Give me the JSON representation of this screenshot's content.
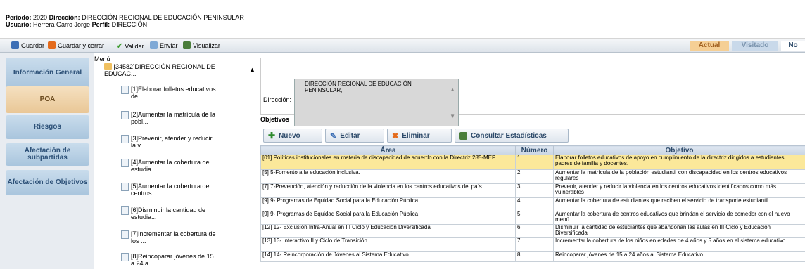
{
  "header": {
    "periodo_label": "Periodo:",
    "periodo_value": "2020",
    "direccion_label": "Dirección:",
    "direccion_value": "DIRECCIÓN REGIONAL DE EDUCACIÓN PENINSULAR",
    "usuario_label": "Usuario:",
    "usuario_value": "Herrera Garro Jorge",
    "perfil_label": "Perfil:",
    "perfil_value": "DIRECCIÓN"
  },
  "toolbar": {
    "guardar": "Guardar",
    "guardar_cerrar": "Guardar y cerrar",
    "validar": "Validar",
    "enviar": "Enviar",
    "visualizar": "Visualizar",
    "tab_actual": "Actual",
    "tab_visitado": "Visitado",
    "tab_no": "No"
  },
  "sidebar": {
    "items": [
      {
        "label": "Información General"
      },
      {
        "label": "POA"
      },
      {
        "label": "Riesgos"
      },
      {
        "label": "Afectación de subpartidas"
      },
      {
        "label": "Afectación de Objetivos"
      }
    ]
  },
  "menu": {
    "title": "Menú",
    "root": "[34582]DIRECCIÓN REGIONAL DE EDUCAC...",
    "items": [
      "[1]Elaborar folletos educativos de ...",
      "[2]Aumentar la matrícula de la pobl...",
      "[3]Prevenir, atender y reducir la v...",
      "[4]Aumentar la cobertura de estudia...",
      "[5]Aumentar la cobertura de centros...",
      "[6]Disminuir la cantidad de estudia...",
      "[7]Incrementar la cobertura de los ...",
      "[8]Reincoparar jóvenes de 15 a 24 a..."
    ]
  },
  "direccion": {
    "label": "Dirección:",
    "value": "DIRECCIÓN REGIONAL DE EDUCACIÓN PENINSULAR,"
  },
  "objetivos": {
    "title": "Objetivos",
    "nuevo": "Nuevo",
    "editar": "Editar",
    "eliminar": "Eliminar",
    "consultar": "Consultar Estadísticas",
    "columns": [
      "Área",
      "Número",
      "Objetivo"
    ],
    "rows": [
      {
        "area": "[01] Políticas institucionales en materia de discapacidad de acuerdo con la Directriz 285-MEP",
        "numero": "1",
        "objetivo": "Elaborar folletos educativos de apoyo en cumplimiento de la directriz dirigidos a estudiantes, padres de familia y docentes."
      },
      {
        "area": "[5] 5-Fomento a la educación inclusiva.",
        "numero": "2",
        "objetivo": "Aumentar la matrícula de la población estudiantil con discapacidad en los centros educativos regulares"
      },
      {
        "area": "[7] 7-Prevención, atención y reducción de la violencia en los centros educativos del país.",
        "numero": "3",
        "objetivo": "Prevenir, atender y reducir la violencia en los centros educativos identificados como más vulnerables"
      },
      {
        "area": "[9] 9- Programas de Equidad Social para la Educación Pública",
        "numero": "4",
        "objetivo": "Aumentar la cobertura de estudiantes que reciben el servicio de transporte estudiantil"
      },
      {
        "area": "[9] 9- Programas de Equidad Social para la Educación Pública",
        "numero": "5",
        "objetivo": "Aumentar la cobertura de centros educativos que brindan el servicio de comedor con el nuevo menú"
      },
      {
        "area": "[12] 12- Exclusión Intra-Anual en III Ciclo y Educación Diversificada",
        "numero": "6",
        "objetivo": "Disminuir la cantidad de estudiantes que abandonan las aulas en III Ciclo y Educación Diversificada"
      },
      {
        "area": "[13] 13- Interactivo II y Ciclo de Transición",
        "numero": "7",
        "objetivo": "Incrementar la cobertura de los niños en edades de 4 años y 5 años en el sistema educativo"
      },
      {
        "area": "[14] 14- Reincorporación de Jóvenes al Sistema Educativo",
        "numero": "8",
        "objetivo": "Reincoparar jóvenes de 15 a 24 años al Sistema Educativo"
      }
    ]
  },
  "colors": {
    "selected_row": "#fbe89a",
    "sidebar_active": "#e9c796",
    "sidebar_button": "#a9c5dd",
    "tab_actual": "#f5cf95",
    "tab_visitado": "#c9d9ea"
  }
}
